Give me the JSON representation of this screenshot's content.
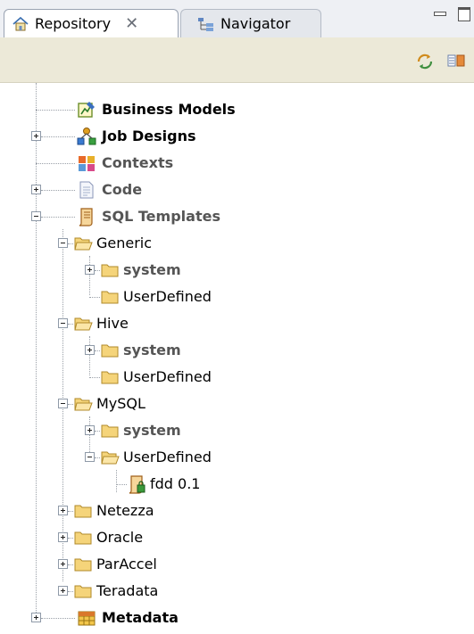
{
  "tabs": [
    {
      "label": "Repository",
      "icon": "house-icon",
      "active": true,
      "close": "✕"
    },
    {
      "label": "Navigator",
      "icon": "navigator-icon",
      "active": false
    }
  ],
  "toolbar": {
    "buttons": [
      {
        "icon": "sync-icon"
      },
      {
        "icon": "link-editor-icon"
      }
    ]
  },
  "tree": {
    "items": [
      {
        "label": "Business Models",
        "icon": "business-model-icon",
        "style": "bold"
      },
      {
        "label": "Job Designs",
        "icon": "job-design-icon",
        "style": "bold"
      },
      {
        "label": "Contexts",
        "icon": "contexts-icon",
        "style": "greybold"
      },
      {
        "label": "Code",
        "icon": "code-icon",
        "style": "greybold"
      },
      {
        "label": "SQL Templates",
        "icon": "sql-templates-icon",
        "style": "greybold"
      },
      {
        "label": "Generic",
        "icon": "folder-open-icon"
      },
      {
        "label": "system",
        "icon": "folder-icon",
        "style": "greybold"
      },
      {
        "label": "UserDefined",
        "icon": "folder-icon"
      },
      {
        "label": "Hive",
        "icon": "folder-open-icon"
      },
      {
        "label": "system",
        "icon": "folder-icon",
        "style": "greybold"
      },
      {
        "label": "UserDefined",
        "icon": "folder-icon"
      },
      {
        "label": "MySQL",
        "icon": "folder-open-icon"
      },
      {
        "label": "system",
        "icon": "folder-icon",
        "style": "greybold"
      },
      {
        "label": "UserDefined",
        "icon": "folder-open-icon"
      },
      {
        "label": "fdd 0.1",
        "icon": "sql-template-file-icon"
      },
      {
        "label": "Netezza",
        "icon": "folder-icon"
      },
      {
        "label": "Oracle",
        "icon": "folder-icon"
      },
      {
        "label": "ParAccel",
        "icon": "folder-icon"
      },
      {
        "label": "Teradata",
        "icon": "folder-icon"
      },
      {
        "label": "Metadata",
        "icon": "metadata-icon",
        "style": "bold"
      }
    ]
  },
  "colors": {
    "folder": "#f5d47a",
    "toolbar_bg": "#ece9d8",
    "tab_bg": "#eef0f4"
  }
}
